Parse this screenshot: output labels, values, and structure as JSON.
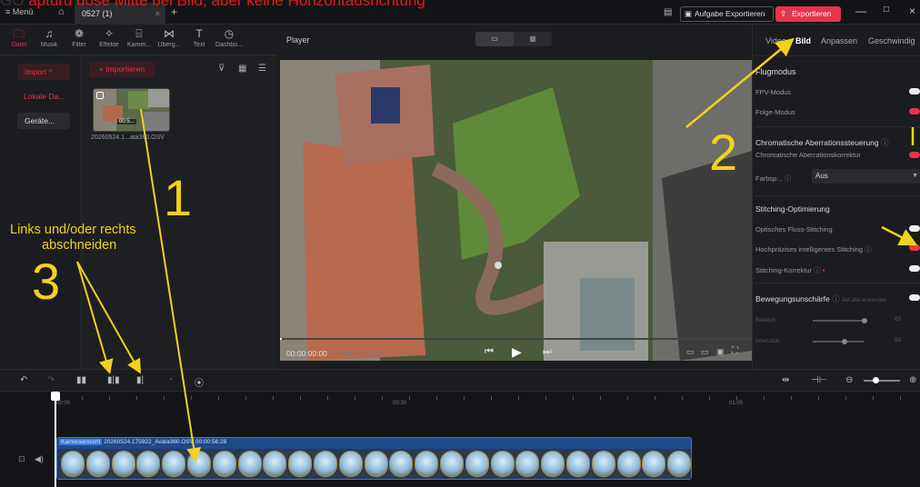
{
  "overlay_title": {
    "pre": "GO",
    "text": "apturu dose Mitte bei Bild, aber keine Horizontausrichtung"
  },
  "titlebar": {
    "menu": "Menü",
    "tab_name": "0527 (1)",
    "task_export": "Aufgabe Exportieren",
    "export": "Exportieren"
  },
  "toolbar": {
    "items": [
      {
        "icon": "folder-icon",
        "label": "Datei"
      },
      {
        "icon": "music-icon",
        "label": "Musik"
      },
      {
        "icon": "filter-icon",
        "label": "Filter"
      },
      {
        "icon": "effects-icon",
        "label": "Effekte"
      },
      {
        "icon": "camera-icon",
        "label": "Kamer..."
      },
      {
        "icon": "transition-icon",
        "label": "Überg..."
      },
      {
        "icon": "text-icon",
        "label": "Text"
      },
      {
        "icon": "dashboard-icon",
        "label": "Dashbo..."
      }
    ]
  },
  "leftnav": {
    "import": "Import ^",
    "local": "Lokale Da...",
    "device": "Geräte..."
  },
  "media": {
    "import_button": "+ Importieren",
    "clip_name": "20260524.1...ata360.OSV",
    "clip_duration": "00:5..."
  },
  "player": {
    "title": "Player",
    "time_current": "00:00:00:00",
    "time_total": "/ 00:00:56:28"
  },
  "right_panel": {
    "tabs": [
      "Video",
      "Bild",
      "Anpassen",
      "Geschwindig"
    ],
    "sections": {
      "flight_mode": "Flugmodus",
      "fpv": "FPV-Modus",
      "follow": "Folge-Modus",
      "chroma": "Chromatische Aberrationssteuerung",
      "chroma_corr": "Chromatische Aberrationskorrektur",
      "color_label": "Farbsp...",
      "color_value": "Aus",
      "stitching": "Stitching-Optimierung",
      "optical": "Optisches Fluss-Stitching",
      "precise": "Hochpräzises intelligentes Stitching",
      "stitch_corr": "Stitching-Korrektur",
      "motion_blur": "Bewegungsunschärfe",
      "apply_all": "Auf alle anwenden",
      "area": "Bereich",
      "area_value": "65",
      "intensity": "Intensität",
      "intensity_value": "50"
    }
  },
  "timeline": {
    "ticks": [
      "00:00",
      "00:30",
      "01:00"
    ],
    "clip_label": "Kameraansicht",
    "clip_file": "20260524.175922_Avata360.OSV",
    "clip_dur": "00:00:56:28"
  },
  "annotations": {
    "num1": "1",
    "num2": "2",
    "num3": "3",
    "note3_line1": "Links und/oder rechts",
    "note3_line2": "abschneiden"
  },
  "colors": {
    "accent": "#e8334a",
    "annotation": "#f2d21a",
    "bg": "#1e1f22"
  }
}
